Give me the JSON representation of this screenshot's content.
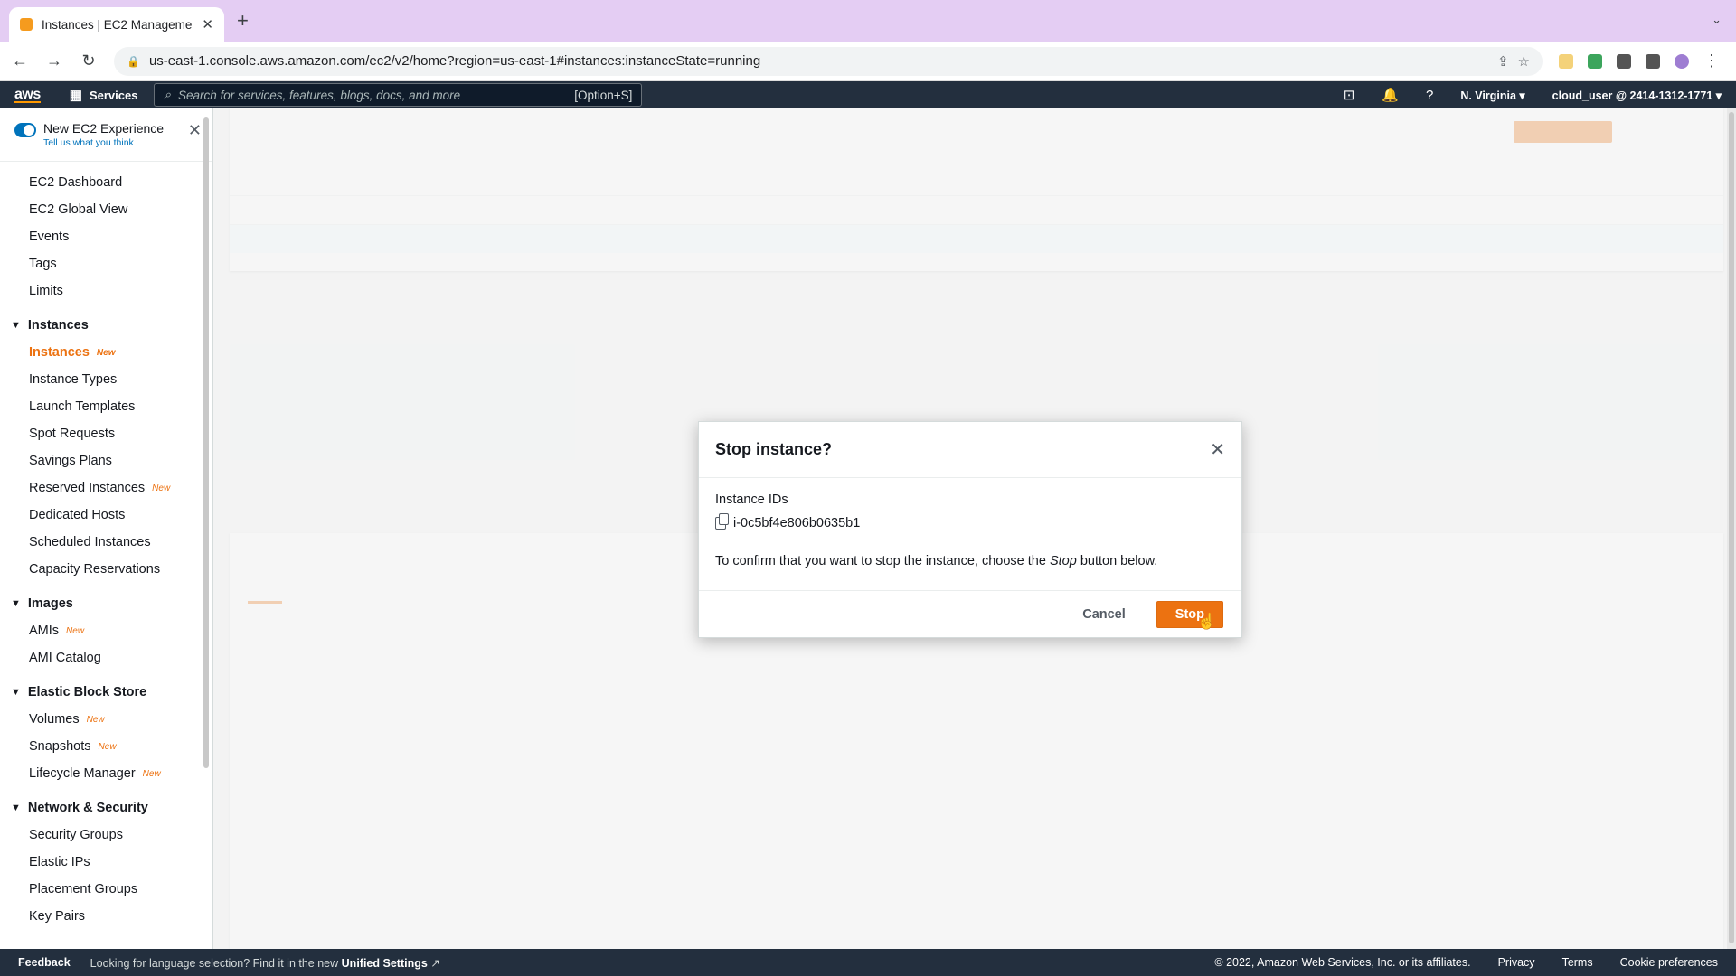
{
  "browser": {
    "tab_title": "Instances | EC2 Management C",
    "url": "us-east-1.console.aws.amazon.com/ec2/v2/home?region=us-east-1#instances:instanceState=running"
  },
  "aws_header": {
    "logo": "aws",
    "services": "Services",
    "search_placeholder": "Search for services, features, blogs, docs, and more",
    "search_shortcut": "[Option+S]",
    "region": "N. Virginia",
    "account": "cloud_user @ 2414-1312-1771"
  },
  "sidebar": {
    "toggle_label": "New EC2 Experience",
    "toggle_sub": "Tell us what you think",
    "top_items": [
      {
        "label": "EC2 Dashboard"
      },
      {
        "label": "EC2 Global View"
      },
      {
        "label": "Events"
      },
      {
        "label": "Tags"
      },
      {
        "label": "Limits"
      }
    ],
    "sections": {
      "instances": "Instances",
      "images": "Images",
      "ebs": "Elastic Block Store",
      "network": "Network & Security"
    },
    "instances_items": [
      {
        "label": "Instances",
        "badge": "New"
      },
      {
        "label": "Instance Types"
      },
      {
        "label": "Launch Templates"
      },
      {
        "label": "Spot Requests"
      },
      {
        "label": "Savings Plans"
      },
      {
        "label": "Reserved Instances",
        "badge": "New"
      },
      {
        "label": "Dedicated Hosts"
      },
      {
        "label": "Scheduled Instances"
      },
      {
        "label": "Capacity Reservations"
      }
    ],
    "images_items": [
      {
        "label": "AMIs",
        "badge": "New"
      },
      {
        "label": "AMI Catalog"
      }
    ],
    "ebs_items": [
      {
        "label": "Volumes",
        "badge": "New"
      },
      {
        "label": "Snapshots",
        "badge": "New"
      },
      {
        "label": "Lifecycle Manager",
        "badge": "New"
      }
    ],
    "network_items": [
      {
        "label": "Security Groups"
      },
      {
        "label": "Elastic IPs"
      },
      {
        "label": "Placement Groups"
      },
      {
        "label": "Key Pairs"
      }
    ]
  },
  "modal": {
    "title": "Stop instance?",
    "ids_label": "Instance IDs",
    "instance_id": "i-0c5bf4e806b0635b1",
    "confirm_before": "To confirm that you want to stop the instance, choose the ",
    "confirm_em": "Stop",
    "confirm_after": " button below.",
    "cancel_label": "Cancel",
    "stop_label": "Stop"
  },
  "footer": {
    "feedback": "Feedback",
    "lang_text": "Looking for language selection? Find it in the new",
    "lang_link": "Unified Settings",
    "copyright": "© 2022, Amazon Web Services, Inc. or its affiliates.",
    "privacy": "Privacy",
    "terms": "Terms",
    "cookies": "Cookie preferences"
  },
  "colors": {
    "accent": "#ec7211",
    "header_bg": "#232f3e",
    "link": "#0073bb"
  }
}
